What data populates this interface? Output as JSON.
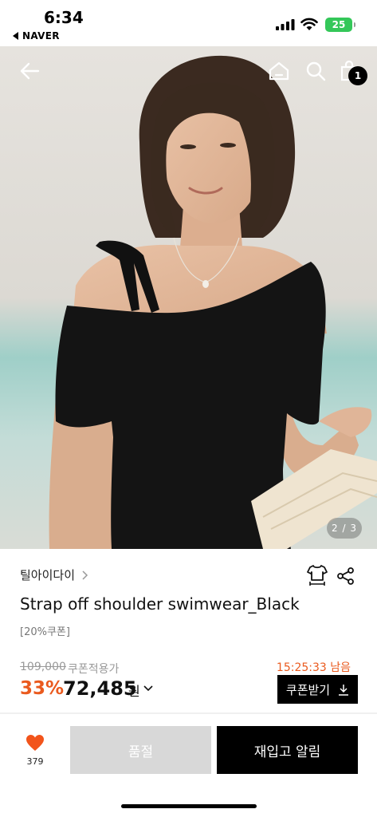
{
  "status_bar": {
    "time": "6:34",
    "back_app": "NAVER",
    "battery": "25"
  },
  "header": {
    "cart_count": "1",
    "icons": [
      "back-arrow-icon",
      "home-icon",
      "search-icon",
      "shopping-bag-icon"
    ]
  },
  "gallery": {
    "page_indicator": "2 / 3"
  },
  "product": {
    "brand": "틸아이다이",
    "title": "Strap off shoulder swimwear_Black",
    "coupon_tag": "[20%쿠폰]",
    "original_price": "109,000",
    "coupon_price_label": "쿠폰적용가",
    "discount": "33%",
    "price": "72,485",
    "currency": "원",
    "timer": "15:25:33 남음",
    "coupon_button": "쿠폰받기"
  },
  "bottom_bar": {
    "like_count": "379",
    "soldout_label": "품절",
    "restock_label": "재입고 알림"
  },
  "colors": {
    "accent": "#ea5a1e",
    "heart": "#f2541b",
    "battery": "#34c759"
  }
}
